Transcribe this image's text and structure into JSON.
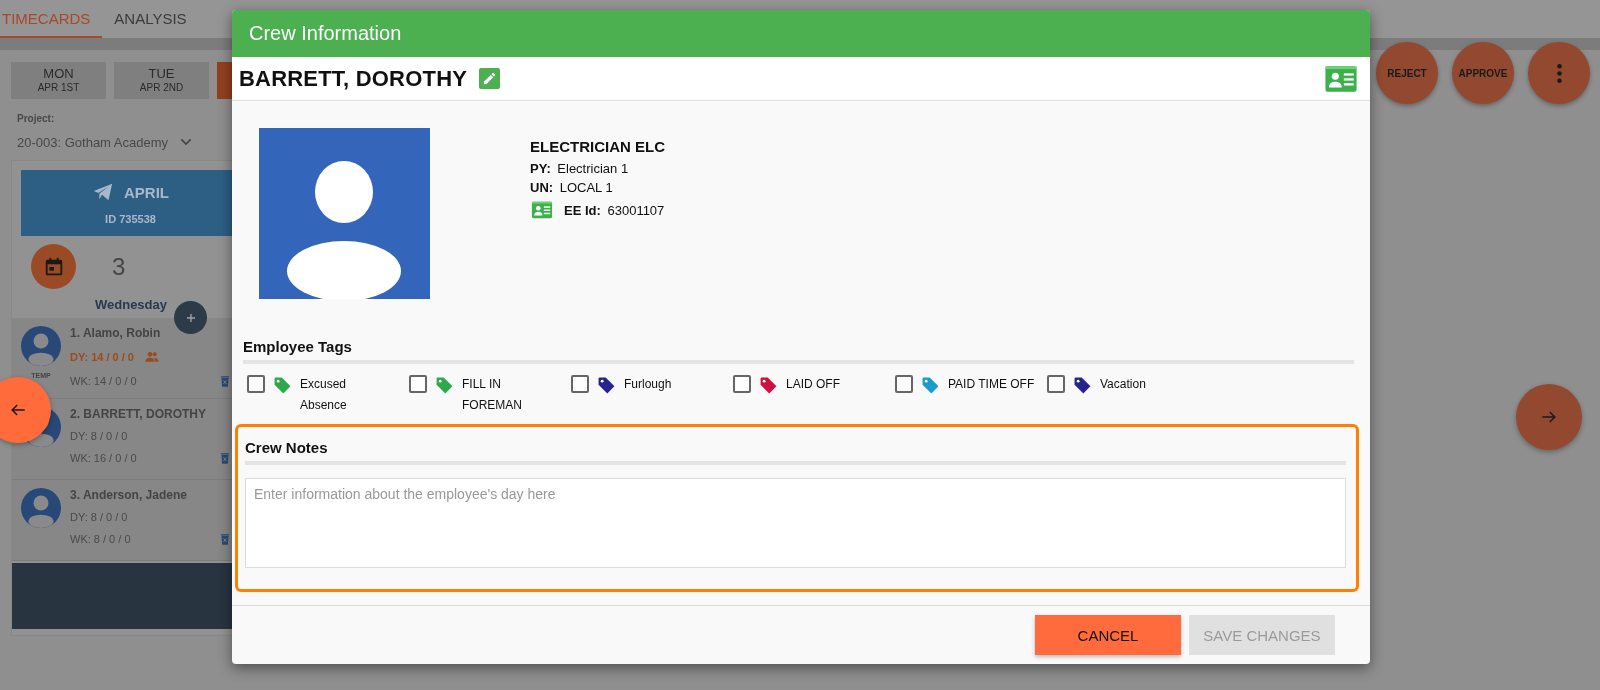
{
  "nav_tabs": [
    {
      "label": "TIMECARDS",
      "selected": true
    },
    {
      "label": "ANALYSIS",
      "selected": false
    }
  ],
  "days": [
    {
      "day": "MON",
      "date": "APR 1ST",
      "selected": false
    },
    {
      "day": "TUE",
      "date": "APR 2ND",
      "selected": false
    },
    {
      "selected": true
    }
  ],
  "project": {
    "label": "Project:",
    "value": "20-003: Gotham Academy"
  },
  "timecard": {
    "title": "APRIL",
    "id": "ID 735538",
    "count": "3",
    "weekday": "Wednesday"
  },
  "crew": [
    {
      "name": "1. Alamo, Robin",
      "day": "DY: 14 / 0 / 0",
      "week": "WK: 14 / 0 / 0",
      "badge": "TEMP",
      "flagged": true
    },
    {
      "name": "2. BARRETT, DOROTHY",
      "day": "DY: 8 / 0 / 0",
      "week": "WK: 16 / 0 / 0",
      "flagged": false
    },
    {
      "name": "3. Anderson, Jadene",
      "day": "DY: 8 / 0 / 0",
      "week": "WK: 8 / 0 / 0",
      "flagged": false
    }
  ],
  "actions": [
    "REJECT",
    "APPROVE"
  ],
  "modal": {
    "title": "Crew Information",
    "employee": "BARRETT, DOROTHY",
    "trade": "ELECTRICIAN ELC",
    "fields": [
      {
        "label": "PY:",
        "value": "Electrician 1"
      },
      {
        "label": "UN:",
        "value": "LOCAL 1"
      },
      {
        "label": "EE Id:",
        "value": "63001107",
        "kind": "id"
      }
    ],
    "tags_heading": "Employee Tags",
    "tags": [
      {
        "label": "Excused Absence",
        "color": "#2ea84a",
        "checked": false
      },
      {
        "label": "FILL IN FOREMAN",
        "color": "#2ea84a",
        "checked": false
      },
      {
        "label": "Furlough",
        "color": "#24248c",
        "checked": false
      },
      {
        "label": "LAID OFF",
        "color": "#cc1040",
        "checked": false
      },
      {
        "label": "PAID TIME OFF",
        "color": "#1a9cc8",
        "checked": false
      },
      {
        "label": "Vacation",
        "color": "#24248c",
        "checked": false
      }
    ],
    "notes_heading": "Crew Notes",
    "notes_placeholder": "Enter information about the employee's day here",
    "buttons": [
      {
        "label": "CANCEL",
        "disabled": false
      },
      {
        "label": "SAVE CHANGES",
        "disabled": true
      }
    ]
  }
}
